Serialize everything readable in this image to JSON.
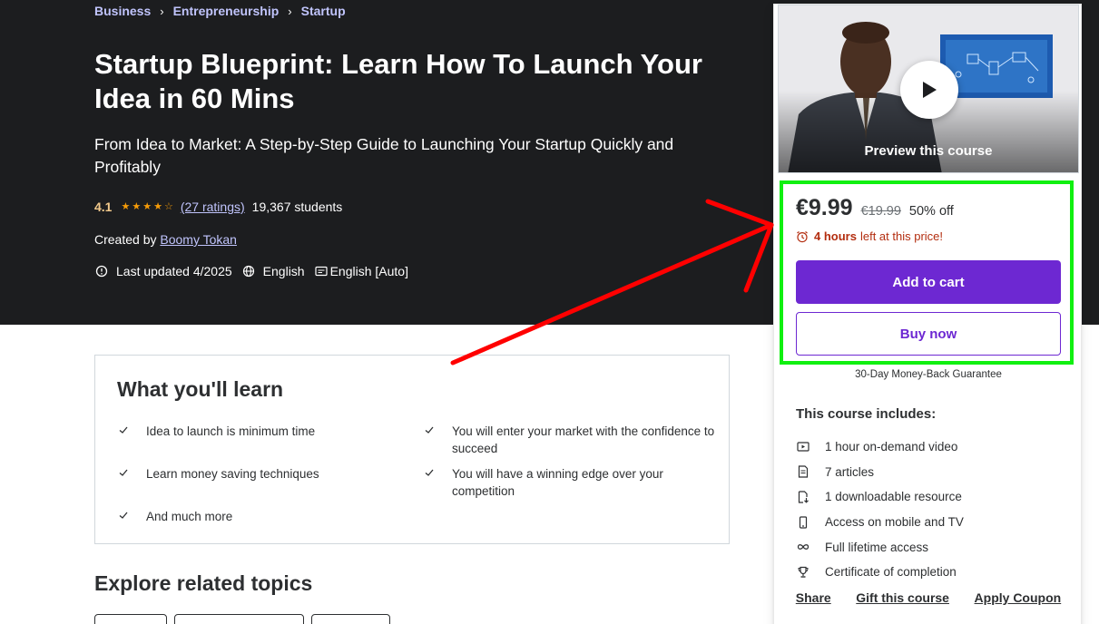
{
  "breadcrumb": [
    "Business",
    "Entrepreneurship",
    "Startup"
  ],
  "course": {
    "title": "Startup Blueprint: Learn How To Launch Your Idea in 60 Mins",
    "subtitle": "From Idea to Market: A Step-by-Step Guide to Launching Your Startup Quickly and Profitably",
    "rating": "4.1",
    "stars": 4.1,
    "ratings_count": "(27 ratings)",
    "students": "19,367 students",
    "created_by_label": "Created by",
    "instructor": "Boomy Tokan",
    "last_updated": "Last updated 4/2025",
    "language": "English",
    "captions": "English [Auto]"
  },
  "learn": {
    "title": "What you'll learn",
    "items": [
      "Idea to launch is minimum time",
      "You will enter your market with the confidence to succeed",
      "Learn money saving techniques",
      "You will have a winning edge over your competition",
      "And much more"
    ]
  },
  "explore_title": "Explore related topics",
  "sidebar": {
    "preview_label": "Preview this course",
    "price_now": "€9.99",
    "price_old": "€19.99",
    "discount": "50% off",
    "timer_bold": "4 hours",
    "timer_rest": "left at this price!",
    "add_to_cart": "Add to cart",
    "buy_now": "Buy now",
    "guarantee": "30-Day Money-Back Guarantee",
    "includes_title": "This course includes:",
    "includes": [
      {
        "icon": "video-icon",
        "label": "1 hour on-demand video"
      },
      {
        "icon": "article-icon",
        "label": "7 articles"
      },
      {
        "icon": "download-file-icon",
        "label": "1 downloadable resource"
      },
      {
        "icon": "mobile-icon",
        "label": "Access on mobile and TV"
      },
      {
        "icon": "infinity-icon",
        "label": "Full lifetime access"
      },
      {
        "icon": "trophy-icon",
        "label": "Certificate of completion"
      }
    ],
    "links": [
      "Share",
      "Gift this course",
      "Apply Coupon"
    ]
  },
  "colors": {
    "hero_bg": "#1c1d1f",
    "accent_purple": "#6d28d2",
    "link_lilac": "#c0c4fc",
    "rating_gold": "#f3ca8c",
    "timer_red": "#b32d0f",
    "highlight_green": "#10f010",
    "arrow_red": "#ff0000"
  }
}
